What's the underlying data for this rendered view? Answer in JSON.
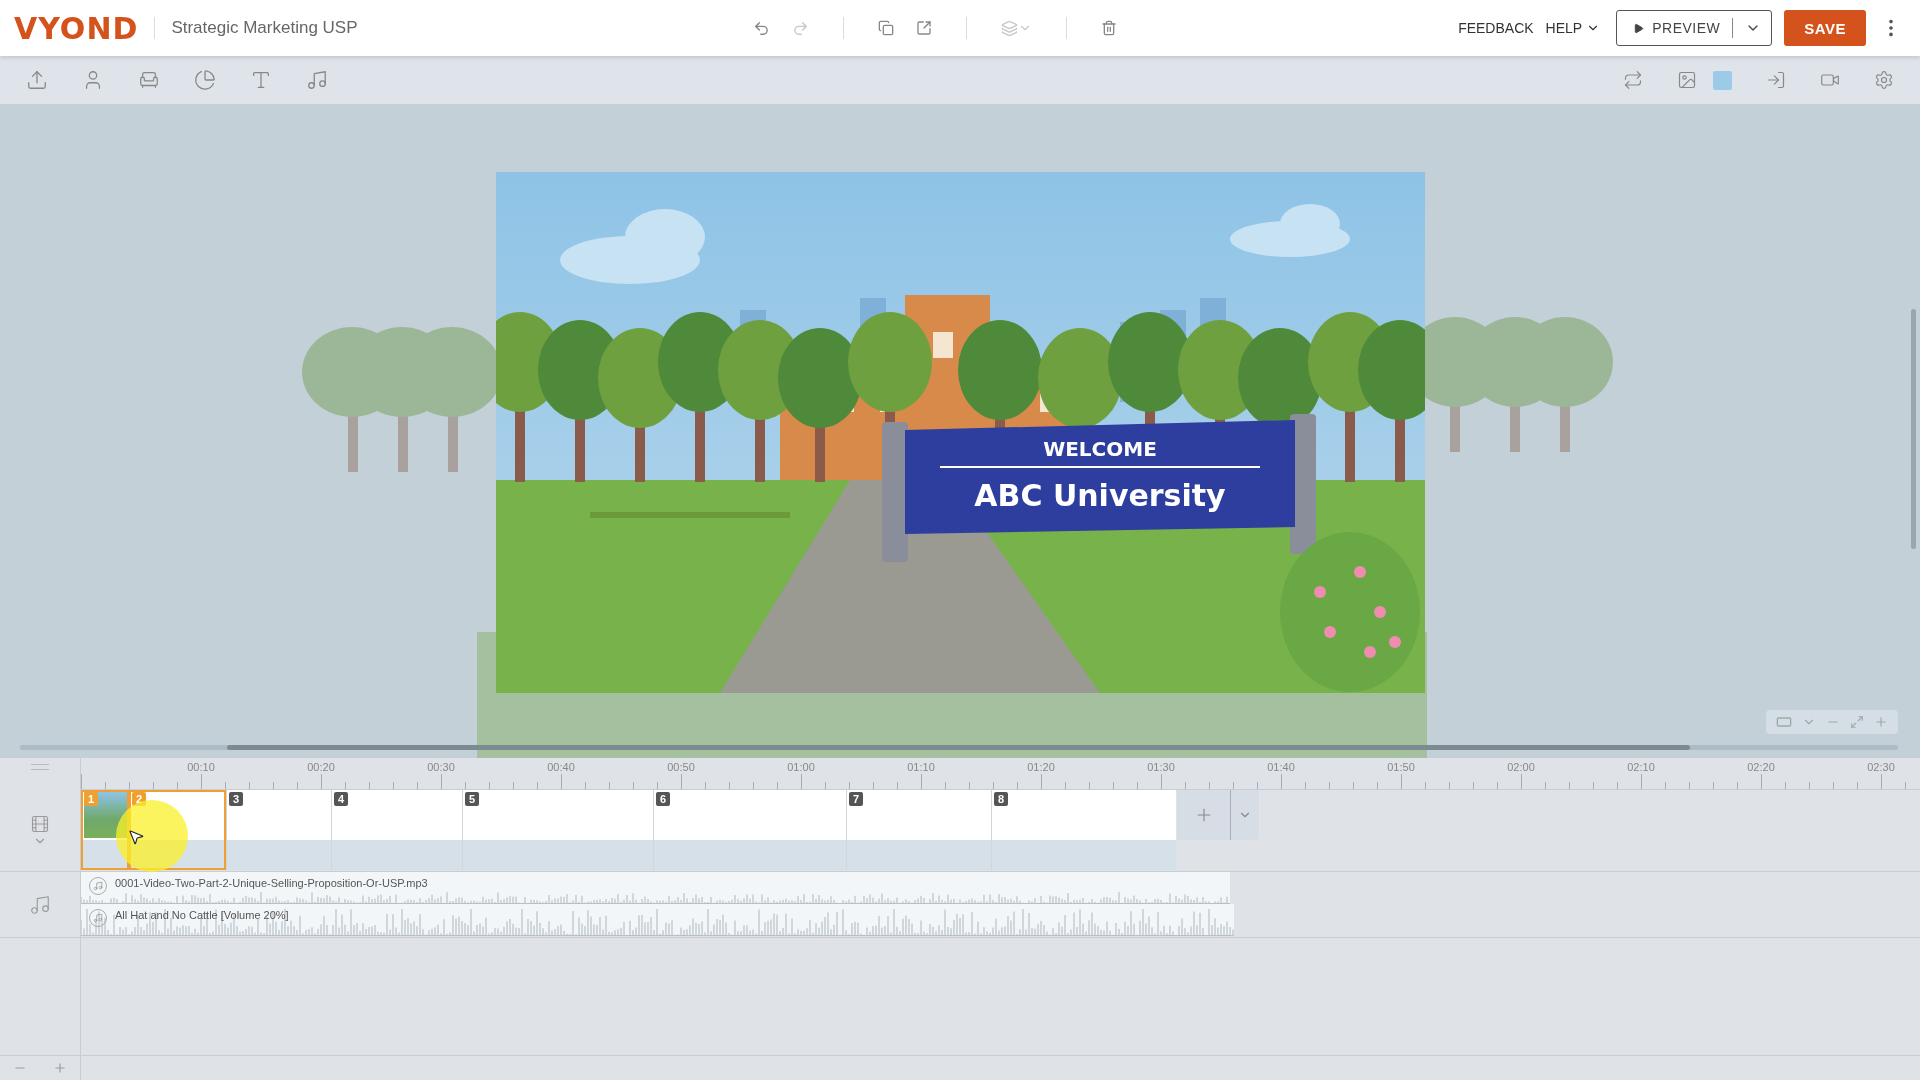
{
  "header": {
    "logo": "VYOND",
    "project_title": "Strategic Marketing USP",
    "feedback": "FEEDBACK",
    "help": "HELP",
    "preview": "PREVIEW",
    "save": "SAVE"
  },
  "stage": {
    "sign_title": "WELCOME",
    "sign_subtitle": "ABC University"
  },
  "timeline": {
    "ticks": [
      "00:10",
      "00:20",
      "00:30",
      "00:40",
      "00:50",
      "01:00",
      "01:10",
      "01:20",
      "01:30",
      "01:40",
      "01:50",
      "02:00",
      "02:10",
      "02:20",
      "02:30"
    ],
    "scenes": [
      {
        "label": "1",
        "selected": true,
        "thumbnail": true
      },
      {
        "label": "2",
        "selected": true,
        "thumbnail": false
      },
      {
        "label": "3",
        "selected": false,
        "thumbnail": false
      },
      {
        "label": "4",
        "selected": false,
        "thumbnail": false
      },
      {
        "label": "5",
        "selected": false,
        "thumbnail": false
      },
      {
        "label": "6",
        "selected": false,
        "thumbnail": false
      },
      {
        "label": "7",
        "selected": false,
        "thumbnail": false
      },
      {
        "label": "8",
        "selected": false,
        "thumbnail": false
      }
    ],
    "audio": [
      {
        "name": "0001-Video-Two-Part-2-Unique-Selling-Proposition-Or-USP.mp3"
      },
      {
        "name": "All Hat and No Cattle [Volume 20%]"
      }
    ]
  }
}
